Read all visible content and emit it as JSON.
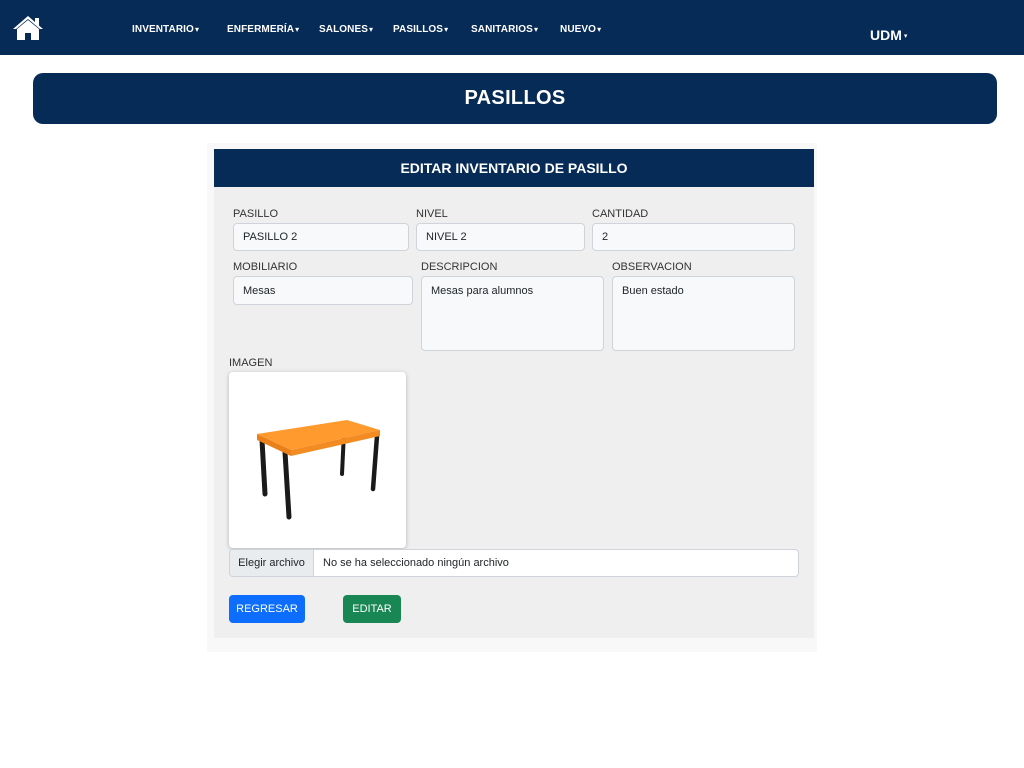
{
  "navbar": {
    "menu": [
      {
        "label": "INVENTARIO",
        "caret": "▾"
      },
      {
        "label": "ENFERMERÍA",
        "caret": "▾"
      },
      {
        "label": "SALONES",
        "caret": "▾"
      },
      {
        "label": "PASILLOS",
        "caret": "▾"
      },
      {
        "label": "SANITARIOS",
        "caret": "▾"
      },
      {
        "label": "NUEVO",
        "caret": "▾"
      }
    ],
    "user": {
      "label": "UDM",
      "caret": "▾"
    },
    "home_icon": "home-icon"
  },
  "page": {
    "title": "PASILLOS"
  },
  "form": {
    "header": "EDITAR INVENTARIO DE PASILLO",
    "fields": {
      "pasillo": {
        "label": "PASILLO",
        "value": "PASILLO 2"
      },
      "nivel": {
        "label": "NIVEL",
        "value": "NIVEL 2"
      },
      "cantidad": {
        "label": "CANTIDAD",
        "value": "2"
      },
      "mobiliario": {
        "label": "MOBILIARIO",
        "value": "Mesas"
      },
      "descripcion": {
        "label": "DESCRIPCION",
        "value": "Mesas para alumnos"
      },
      "observacion": {
        "label": "OBSERVACION",
        "value": "Buen estado"
      }
    },
    "image": {
      "label": "IMAGEN",
      "depicts": "table-image"
    },
    "file_input": {
      "button_label": "Elegir archivo",
      "status": "No se ha seleccionado ningún archivo"
    },
    "buttons": {
      "back": "REGRESAR",
      "edit": "EDITAR"
    }
  },
  "colors": {
    "navbar_bg": "#062b57",
    "card_bg": "#efefef",
    "back_button": "#0d6efd",
    "edit_button": "#198754",
    "table_top": "#ff9a2e",
    "table_legs": "#1a1a1a"
  }
}
